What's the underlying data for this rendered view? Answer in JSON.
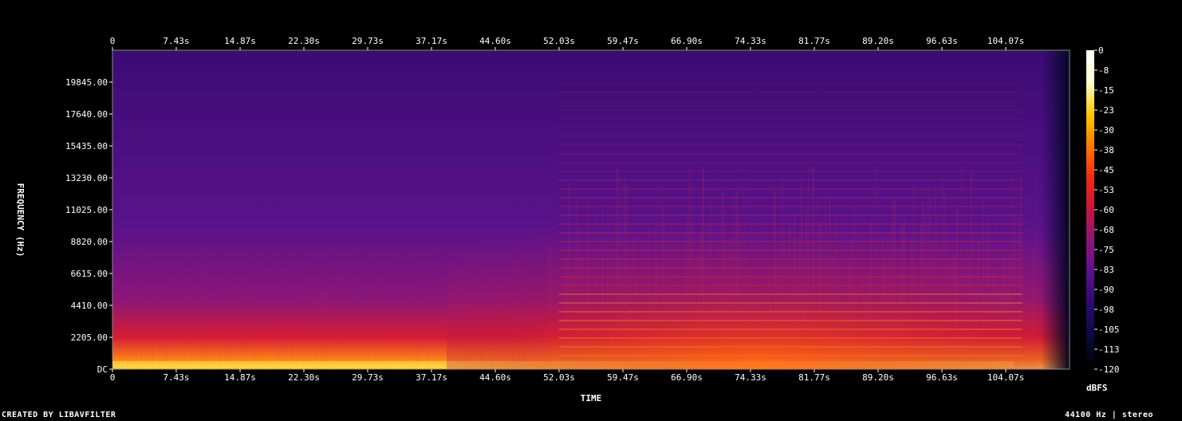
{
  "chart_data": {
    "type": "heatmap",
    "title": "",
    "xlabel": "TIME",
    "ylabel": "FREQUENCY (Hz)",
    "x_ticks": [
      "0",
      "7.43s",
      "14.87s",
      "22.30s",
      "29.73s",
      "37.17s",
      "44.60s",
      "52.03s",
      "59.47s",
      "66.90s",
      "74.33s",
      "81.77s",
      "89.20s",
      "96.63s",
      "104.07s"
    ],
    "x_tick_values_s": [
      0,
      7.43,
      14.87,
      22.3,
      29.73,
      37.17,
      44.6,
      52.03,
      59.47,
      66.9,
      74.33,
      81.77,
      89.2,
      96.63,
      104.07
    ],
    "xlim": [
      0,
      111.5
    ],
    "y_ticks": [
      "DC",
      "2205.00",
      "4410.00",
      "6615.00",
      "8820.00",
      "11025.00",
      "13230.00",
      "15435.00",
      "17640.00",
      "19845.00"
    ],
    "y_tick_values_hz": [
      0,
      2205,
      4410,
      6615,
      8820,
      11025,
      13230,
      15435,
      17640,
      19845
    ],
    "ylim": [
      0,
      22050
    ],
    "colorbar": {
      "label": "dBFS",
      "ticks": [
        "0",
        "-8",
        "-15",
        "-23",
        "-30",
        "-38",
        "-45",
        "-53",
        "-60",
        "-68",
        "-75",
        "-83",
        "-90",
        "-98",
        "-105",
        "-113",
        "-120"
      ],
      "range": [
        -120,
        0
      ],
      "stops": [
        "#000000",
        "#0a0a3c",
        "#2a0a6e",
        "#5a0f8f",
        "#8a1678",
        "#c0183c",
        "#ee2a10",
        "#ff7a00",
        "#ffc800",
        "#ffffd0",
        "#ffffff"
      ]
    },
    "grid": false
  },
  "footer": {
    "credit": "CREATED BY LIBAVFILTER",
    "sample_info": "44100 Hz | stereo"
  }
}
